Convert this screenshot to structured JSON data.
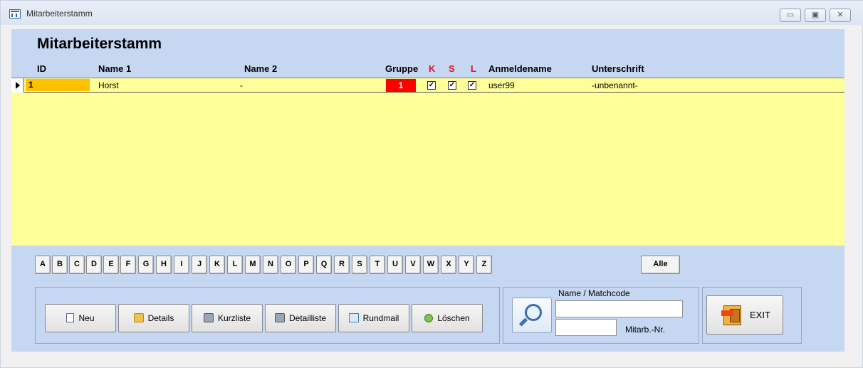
{
  "window": {
    "title": "Mitarbeiterstamm",
    "controls": [
      "▭",
      "▣",
      "✕"
    ]
  },
  "form": {
    "title": "Mitarbeiterstamm"
  },
  "columns": {
    "id": "ID",
    "name1": "Name 1",
    "name2": "Name 2",
    "gruppe": "Gruppe",
    "k": "K",
    "s": "S",
    "l": "L",
    "anmeldename": "Anmeldename",
    "unterschrift": "Unterschrift"
  },
  "rows": [
    {
      "id": "1",
      "name1": "Horst",
      "name2": "-",
      "gruppe": "1",
      "k": true,
      "s": true,
      "l": true,
      "anmeldename": "user99",
      "unterschrift": "-unbenannt-"
    }
  ],
  "letters": [
    "A",
    "B",
    "C",
    "D",
    "E",
    "F",
    "G",
    "H",
    "I",
    "J",
    "K",
    "L",
    "M",
    "N",
    "O",
    "P",
    "Q",
    "R",
    "S",
    "T",
    "U",
    "V",
    "W",
    "X",
    "Y",
    "Z"
  ],
  "all_label": "Alle",
  "buttons": {
    "neu": "Neu",
    "details": "Details",
    "kurzliste": "Kurzliste",
    "detailliste": "Detailliste",
    "rundmail": "Rundmail",
    "loeschen": "Löschen"
  },
  "search": {
    "label": "Name / Matchcode",
    "matchcode_value": "",
    "nr_value": "",
    "nr_label": "Mitarb.-Nr."
  },
  "exit_label": "EXIT",
  "icons": [
    "window-icon",
    "new-document-icon",
    "folder-icon",
    "printer-icon",
    "printer-icon",
    "email-icon",
    "delete-icon",
    "magnifier-icon",
    "exit-door-icon"
  ],
  "colors": {
    "form_bg": "#c6d7f2",
    "grid_bg": "#ffff99",
    "id_cell": "#ffc000",
    "group_cell": "#ff0000",
    "header_red": "#e8101a"
  }
}
